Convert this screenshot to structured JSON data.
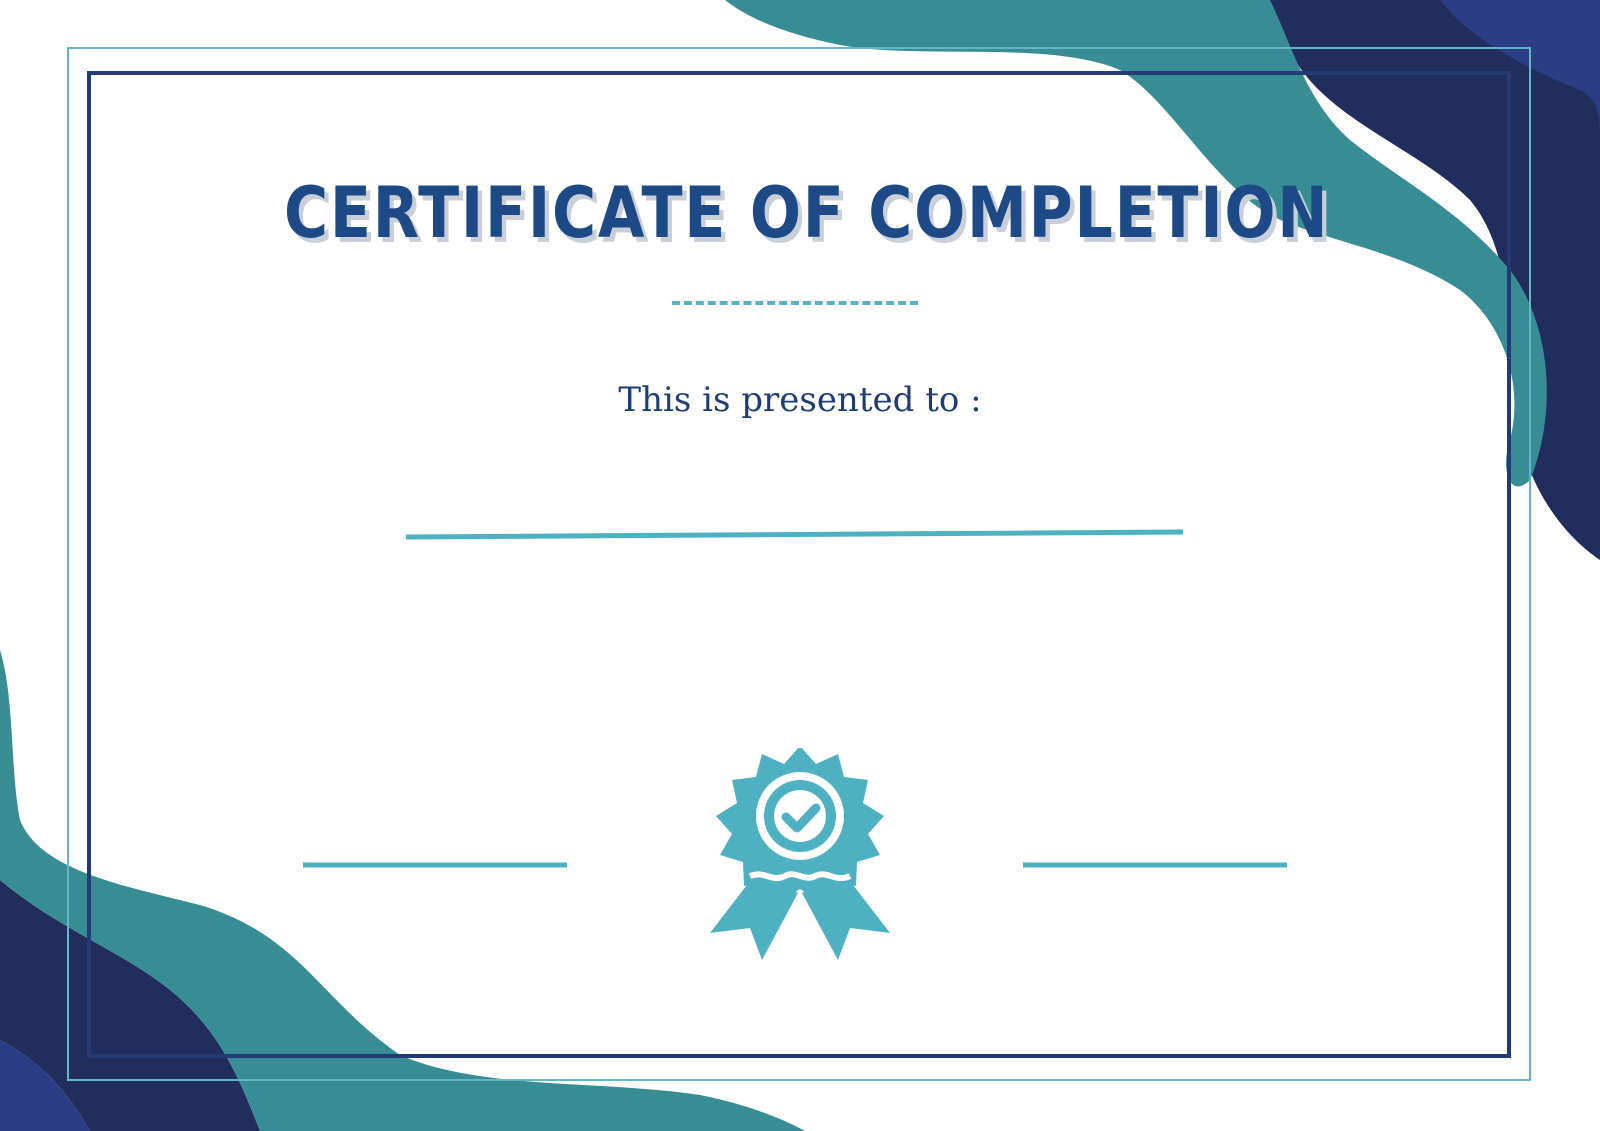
{
  "certificate": {
    "title": "CERTIFICATE OF COMPLETION",
    "subtitle": "This is presented to :"
  },
  "colors": {
    "navy": "#233a74",
    "teal": "#388d95",
    "light_teal": "#4eb1c1",
    "royal_blue": "#2a3d85",
    "title_blue": "#1d4a86"
  },
  "icons": {
    "badge": "award-ribbon-checkmark-icon"
  }
}
